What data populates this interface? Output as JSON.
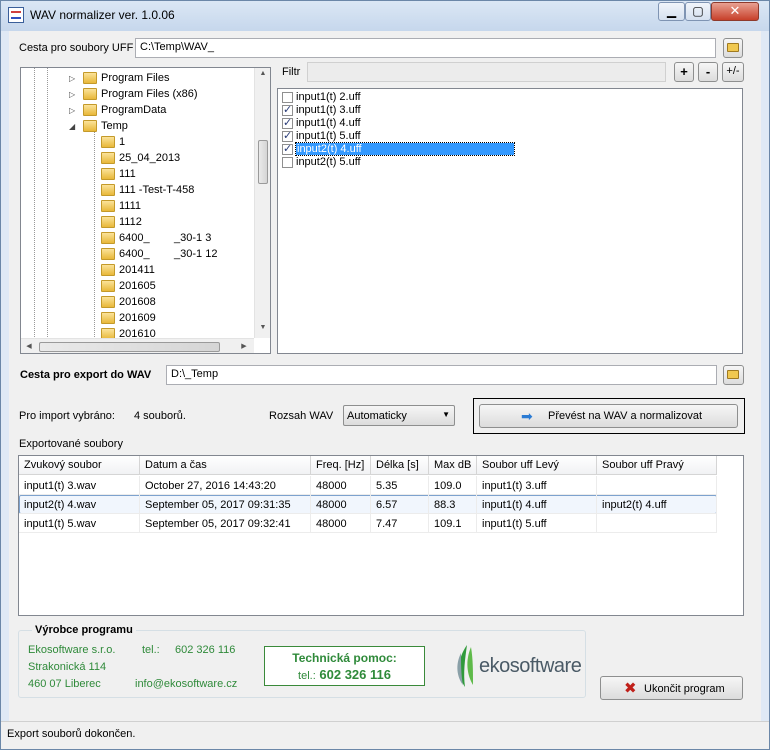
{
  "window": {
    "title": "WAV normalizer ver. 1.0.06"
  },
  "source_path": {
    "label": "Cesta pro soubory UFF",
    "value": "C:\\Temp\\WAV_"
  },
  "tree": {
    "items": [
      {
        "label": "Program Files",
        "level": 0,
        "expander": "▷"
      },
      {
        "label": "Program Files (x86)",
        "level": 0,
        "expander": "▷"
      },
      {
        "label": "ProgramData",
        "level": 0,
        "expander": "▷"
      },
      {
        "label": "Temp",
        "level": 0,
        "expander": "◢"
      },
      {
        "label": "1",
        "level": 1
      },
      {
        "label": "25_04_2013",
        "level": 1
      },
      {
        "label": "111",
        "level": 1
      },
      {
        "label": "111 -Test-T-458",
        "level": 1
      },
      {
        "label": "1111",
        "level": 1
      },
      {
        "label": "1112",
        "level": 1
      },
      {
        "label": "6400_        _30-1 3",
        "level": 1
      },
      {
        "label": "6400_        _30-1 12",
        "level": 1
      },
      {
        "label": "201411",
        "level": 1
      },
      {
        "label": "201605",
        "level": 1
      },
      {
        "label": "201608",
        "level": 1
      },
      {
        "label": "201609",
        "level": 1
      },
      {
        "label": "201610",
        "level": 1
      }
    ]
  },
  "filter": {
    "label": "Filtr",
    "value": "",
    "add_label": "+",
    "remove_label": "-",
    "toggle_label": "+/-"
  },
  "files": [
    {
      "label": "input1(t) 2.uff",
      "checked": false,
      "selected": false
    },
    {
      "label": "input1(t) 3.uff",
      "checked": true,
      "selected": false
    },
    {
      "label": "input1(t) 4.uff",
      "checked": true,
      "selected": false
    },
    {
      "label": "input1(t) 5.uff",
      "checked": true,
      "selected": false
    },
    {
      "label": "input2(t) 4.uff",
      "checked": true,
      "selected": true
    },
    {
      "label": "input2(t) 5.uff",
      "checked": false,
      "selected": false
    }
  ],
  "export_path": {
    "label": "Cesta pro export do WAV",
    "value": "D:\\_Temp"
  },
  "import_info": {
    "label": "Pro import vybráno:",
    "value": "4 souborů."
  },
  "range": {
    "label": "Rozsah WAV",
    "value": "Automaticky"
  },
  "convert_button": {
    "label": "Převést na WAV a normalizovat"
  },
  "exported": {
    "label": "Exportované soubory",
    "columns": [
      "Zvukový soubor",
      "Datum a čas",
      "Freq. [Hz]",
      "Délka [s]",
      "Max dB",
      "Soubor uff Levý",
      "Soubor uff Pravý"
    ],
    "rows": [
      [
        "input1(t) 3.wav",
        "October 27, 2016 14:43:20",
        "48000",
        "5.35",
        "109.0",
        "input1(t) 3.uff",
        ""
      ],
      [
        "input2(t) 4.wav",
        "September 05, 2017 09:31:35",
        "48000",
        "6.57",
        "88.3",
        "input1(t) 4.uff",
        "input2(t) 4.uff"
      ],
      [
        "input1(t) 5.wav",
        "September 05, 2017 09:32:41",
        "48000",
        "7.47",
        "109.1",
        "input1(t) 5.uff",
        ""
      ]
    ]
  },
  "vendor": {
    "heading": "Výrobce programu",
    "company": "Ekosoftware s.r.o.",
    "street": "Strakonická 114",
    "city": "460 07  Liberec",
    "phone_label": "tel.:",
    "phone": "602 326 116",
    "email": "info@ekosoftware.cz",
    "help_title": "Technická pomoc:",
    "help_phone_label": "tel.:",
    "help_phone": "602 326 116",
    "logo_text": "ekosoftware"
  },
  "exit_button": {
    "label": "Ukončit program"
  },
  "status": {
    "text": "Export souborů dokončen."
  },
  "colors": {
    "accent_green": "#2f8a3a",
    "selection_blue": "#3399ff"
  }
}
